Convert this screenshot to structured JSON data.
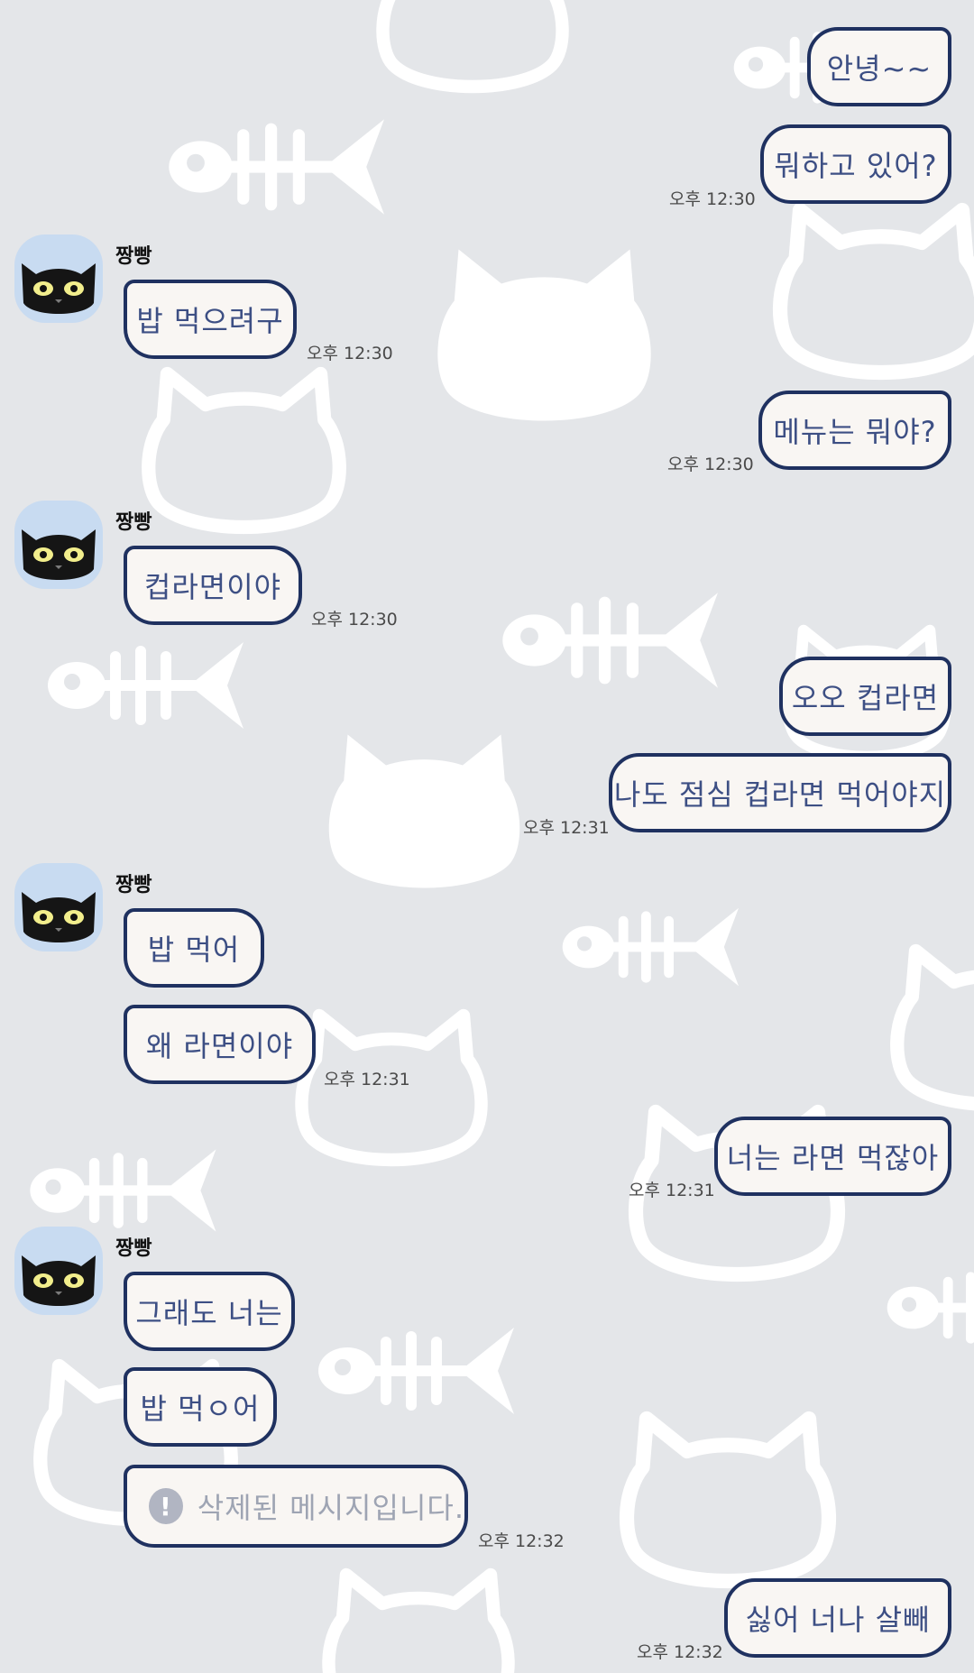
{
  "contact": {
    "name": "짱빵"
  },
  "messages": [
    {
      "from": "me",
      "text": "안녕~~"
    },
    {
      "from": "me",
      "text": "뭐하고 있어?",
      "time": "오후 12:30"
    },
    {
      "from": "them",
      "text": "밥 먹으려구",
      "time": "오후 12:30"
    },
    {
      "from": "me",
      "text": "메뉴는 뭐야?",
      "time": "오후 12:30"
    },
    {
      "from": "them",
      "text": "컵라면이야",
      "time": "오후 12:30"
    },
    {
      "from": "me",
      "text": "오오 컵라면"
    },
    {
      "from": "me",
      "text": "나도 점심 컵라면 먹어야지",
      "time": "오후 12:31"
    },
    {
      "from": "them",
      "text": "밥 먹어"
    },
    {
      "from": "them",
      "text": "왜 라면이야",
      "time": "오후 12:31"
    },
    {
      "from": "me",
      "text": "너는 라면 먹잖아",
      "time": "오후 12:31"
    },
    {
      "from": "them",
      "text": "그래도 너는"
    },
    {
      "from": "them",
      "text": "밥 먹ㅇ어"
    },
    {
      "from": "them",
      "text": "삭제된 메시지입니다.",
      "deleted": true,
      "icon": "exclamation-icon",
      "time": "오후 12:32"
    },
    {
      "from": "me",
      "text": "싫어 너나 살빼",
      "time": "오후 12:32"
    }
  ],
  "colors": {
    "background": "#e4e6e9",
    "pattern": "#ffffff",
    "bubble_fill": "#f9f6f3",
    "bubble_border": "#1f3160",
    "bubble_text": "#3d4f84",
    "deleted_text": "#9ea4b3"
  }
}
